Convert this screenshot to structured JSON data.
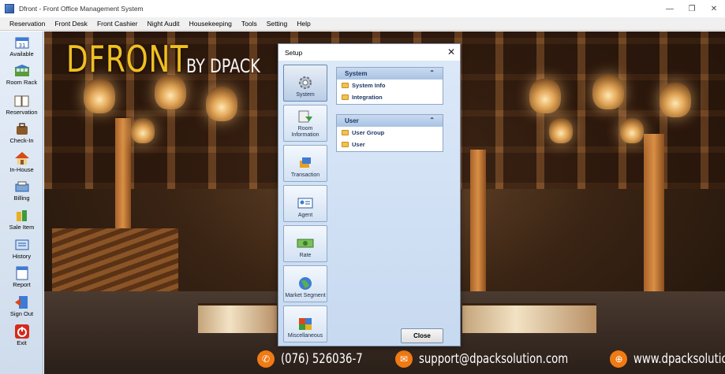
{
  "window": {
    "title": "Dfront - Front Office Management System",
    "controls": [
      "—",
      "❐",
      "✕"
    ]
  },
  "menu": [
    "Reservation",
    "Front Desk",
    "Front Cashier",
    "Night Audit",
    "Housekeeping",
    "Tools",
    "Setting",
    "Help"
  ],
  "sidebar": {
    "items": [
      {
        "label": "Available",
        "icon": "calendar-icon"
      },
      {
        "label": "Room Rack",
        "icon": "room-rack-icon"
      },
      {
        "label": "Reservation",
        "icon": "book-icon"
      },
      {
        "label": "Check-In",
        "icon": "luggage-icon"
      },
      {
        "label": "In-House",
        "icon": "house-icon"
      },
      {
        "label": "Billing",
        "icon": "billing-icon"
      },
      {
        "label": "Sale Item",
        "icon": "sale-item-icon"
      },
      {
        "label": "History",
        "icon": "history-icon"
      },
      {
        "label": "Report",
        "icon": "report-icon"
      },
      {
        "label": "Sign Out",
        "icon": "sign-out-icon"
      },
      {
        "label": "Exit",
        "icon": "power-icon"
      }
    ]
  },
  "background": {
    "logo": "DFRONT",
    "tagline": "BY DPACK",
    "phone": "(076) 526036-7",
    "email": "support@dpacksolution.com",
    "website": "www.dpacksolution.com"
  },
  "dialog": {
    "title": "Setup",
    "nav": [
      {
        "label": "System",
        "icon": "gear-icon",
        "active": true
      },
      {
        "label": "Room Information",
        "icon": "room-info-icon"
      },
      {
        "label": "Transaction",
        "icon": "transaction-icon"
      },
      {
        "label": "Agent",
        "icon": "agent-icon"
      },
      {
        "label": "Rate",
        "icon": "rate-icon"
      },
      {
        "label": "Market Segment",
        "icon": "globe-icon"
      },
      {
        "label": "Miscellaneous",
        "icon": "misc-icon"
      }
    ],
    "panels": [
      {
        "title": "System",
        "items": [
          "System Info",
          "Integration"
        ]
      },
      {
        "title": "User",
        "items": [
          "User Group",
          "User"
        ]
      }
    ],
    "close_label": "Close"
  },
  "colors": {
    "accent_orange": "#f07a14",
    "logo_gold": "#f0c020",
    "panel_header": "#a9c3e4"
  }
}
